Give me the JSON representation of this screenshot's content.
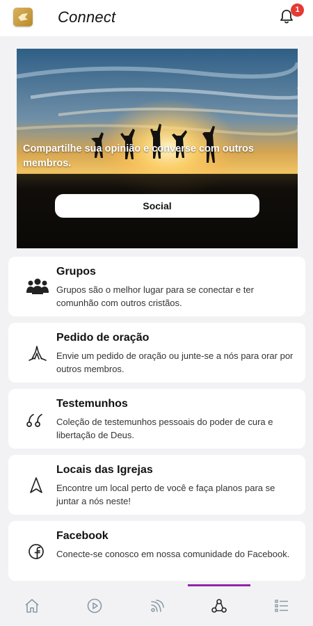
{
  "header": {
    "title": "Connect",
    "notification_count": "1"
  },
  "hero": {
    "text": "Compartilhe sua opinião e converse com outros membros.",
    "button_label": "Social"
  },
  "cards": [
    {
      "icon": "people-group-icon",
      "title": "Grupos",
      "description": "Grupos são o melhor lugar para se conectar e ter comunhão com outros cristãos."
    },
    {
      "icon": "praying-hands-icon",
      "title": "Pedido de oração",
      "description": "Envie um pedido de oração ou junte-se a nós para orar por outros membros."
    },
    {
      "icon": "quote-icon",
      "title": "Testemunhos",
      "description": "Coleção de testemunhos pessoais do poder de cura e libertação de Deus."
    },
    {
      "icon": "navigation-arrow-icon",
      "title": "Locais das Igrejas",
      "description": "Encontre um local perto de você e faça planos para se juntar a nós neste!"
    },
    {
      "icon": "facebook-icon",
      "title": "Facebook",
      "description": "Conecte-se conosco em nossa comunidade do Facebook."
    }
  ],
  "bottom_nav": {
    "items": [
      "home-icon",
      "play-icon",
      "broadcast-icon",
      "connect-icon",
      "list-icon"
    ],
    "active_index": 3,
    "active_color": "#8e24aa"
  },
  "colors": {
    "brand_gold": "#c9a046",
    "badge_red": "#e53935"
  }
}
